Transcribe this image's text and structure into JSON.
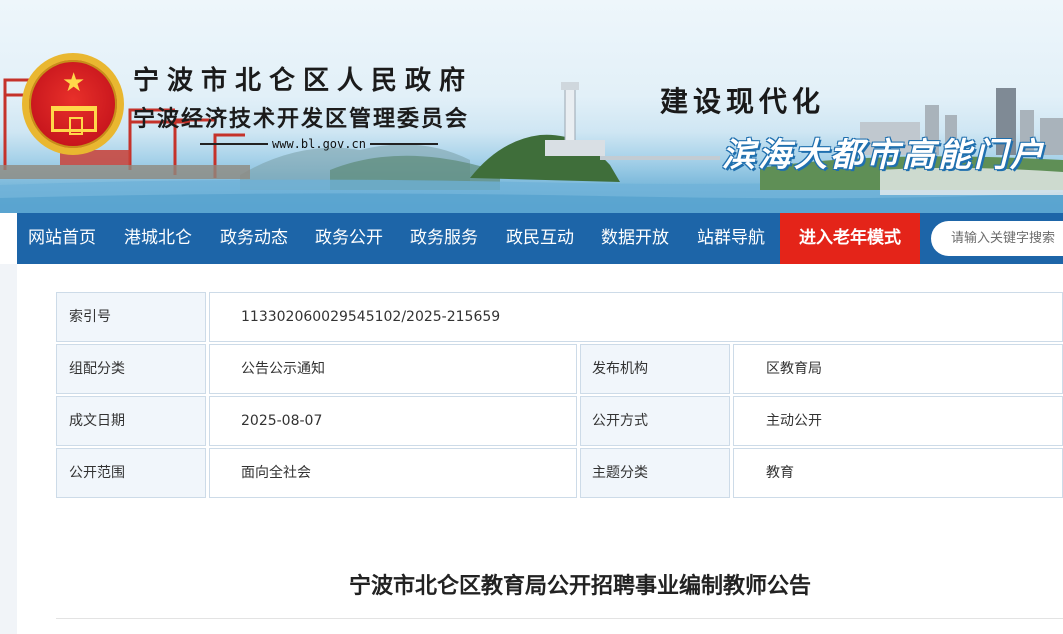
{
  "header": {
    "org_name": "宁波市北仑区人民政府",
    "org_sub": "宁波经济技术开发区管理委员会",
    "url": "www.bl.gov.cn",
    "slogan_main": "建设现代化",
    "slogan_sub": "滨海大都市高能门户",
    "emblem_icon": "national-emblem-icon"
  },
  "nav": {
    "items": [
      "网站首页",
      "港城北仑",
      "政务动态",
      "政务公开",
      "政务服务",
      "政民互动",
      "数据开放",
      "站群导航"
    ],
    "elder_mode": "进入老年模式",
    "search_placeholder": "请输入关键字搜索"
  },
  "info": {
    "index_label": "索引号",
    "index_value": "113302060029545102/2025-215659",
    "category_label": "组配分类",
    "category_value": "公告公示通知",
    "publisher_label": "发布机构",
    "publisher_value": "区教育局",
    "date_label": "成文日期",
    "date_value": "2025-08-07",
    "method_label": "公开方式",
    "method_value": "主动公开",
    "scope_label": "公开范围",
    "scope_value": "面向全社会",
    "topic_label": "主题分类",
    "topic_value": "教育"
  },
  "document": {
    "title": "宁波市北仑区教育局公开招聘事业编制教师公告"
  },
  "colors": {
    "nav_bg": "#1d65a8",
    "elder_bg": "#e42419",
    "label_bg": "#f1f6fb",
    "border": "#cddbe8"
  }
}
